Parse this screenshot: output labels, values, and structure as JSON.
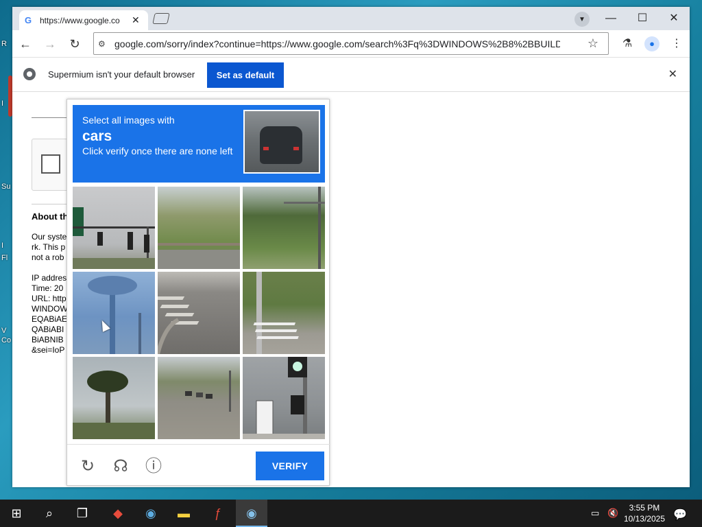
{
  "desktop": {
    "labels": [
      "R",
      "I",
      "Su",
      "I",
      "Fl",
      "V",
      "Co"
    ]
  },
  "tab": {
    "title": "https://www.google.co",
    "favicon": "G"
  },
  "address": {
    "url": "google.com/sorry/index?continue=https://www.google.com/search%3Fq%3DWINDOWS%2B8%2BBUILD%2..."
  },
  "infobar": {
    "message": "Supermium isn't your default browser",
    "button": "Set as default"
  },
  "page": {
    "about_heading": "About th",
    "lines": [
      "Our syste",
      "rk. This p",
      "not a rob",
      "",
      "IP addres",
      "Time: 20",
      "URL: http",
      "WINDOW",
      "EQABiAE",
      "QABiABI",
      "BiABNIB",
      "&sei=IoP"
    ]
  },
  "captcha": {
    "line1": "Select all images with",
    "target": "cars",
    "line3": "Click verify once there are none left",
    "verify_label": "VERIFY",
    "tiles": [
      "traffic-lights",
      "hillside-guardrail",
      "trees-pole",
      "palm-tree-blue",
      "road-crosswalk",
      "crosswalk-pole",
      "palm-tree",
      "street-with-cars",
      "traffic-signal-sign"
    ]
  },
  "taskbar": {
    "time": "3:55 PM",
    "date": "10/13/2025"
  },
  "colors": {
    "captcha_blue": "#1a73e8",
    "set_default_blue": "#0b57d0",
    "taskbar": "#1b1b1b"
  }
}
